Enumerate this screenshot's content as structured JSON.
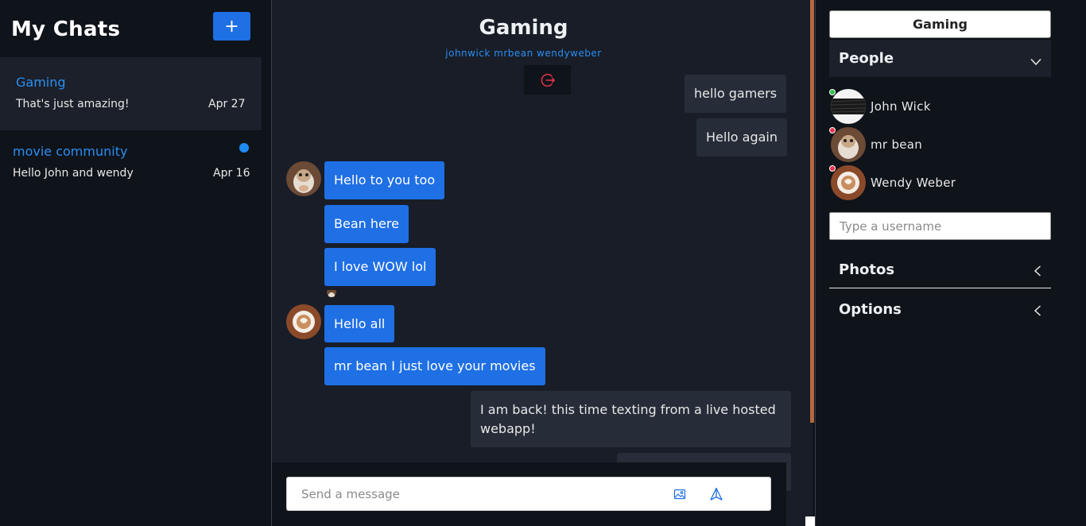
{
  "sidebar": {
    "title": "My Chats",
    "add_button": "+",
    "chats": [
      {
        "name": "Gaming",
        "preview": "That's just amazing!",
        "date": "Apr 27",
        "active": true,
        "unread": false
      },
      {
        "name": "movie community",
        "preview": "Hello John and wendy",
        "date": "Apr 16",
        "active": false,
        "unread": true
      }
    ]
  },
  "chat": {
    "title": "Gaming",
    "members": "johnwick mrbean wendyweber",
    "messages": [
      {
        "text": "hello gamers",
        "from": "me"
      },
      {
        "text": "Hello again",
        "from": "me"
      },
      {
        "text": "Hello to you too",
        "from": "mrbean"
      },
      {
        "text": "Bean here",
        "from": "mrbean"
      },
      {
        "text": "I love WOW lol",
        "from": "mrbean"
      },
      {
        "text": "Hello all",
        "from": "wendyweber"
      },
      {
        "text": "mr bean I just love your movies",
        "from": "wendyweber"
      },
      {
        "text": "I am back! this time texting from a live hosted webapp!",
        "from": "me"
      }
    ],
    "composer_placeholder": "Send a message"
  },
  "settings": {
    "chat_title": "Gaming",
    "people_label": "People",
    "people": [
      {
        "name": "John Wick",
        "online": true
      },
      {
        "name": "mr bean",
        "online": false
      },
      {
        "name": "Wendy Weber",
        "online": false
      }
    ],
    "username_placeholder": "Type a username",
    "photos_label": "Photos",
    "options_label": "Options"
  },
  "colors": {
    "accent": "#1f6fe5",
    "link": "#2b8ef0",
    "online": "#2ec24a",
    "offline": "#e8344a",
    "scrollbar": "#b4683f"
  }
}
